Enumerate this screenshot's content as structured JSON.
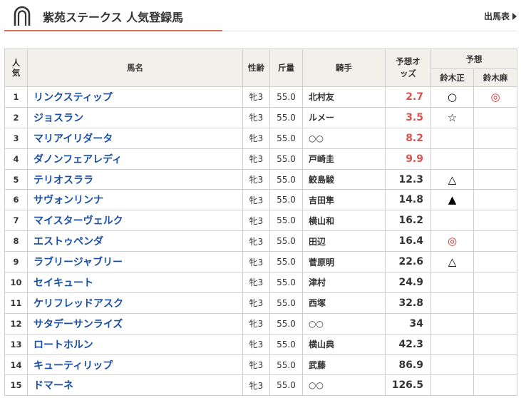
{
  "header": {
    "title": "紫苑ステークス 人気登録馬",
    "entry_link": "出馬表"
  },
  "columns": {
    "rank": "人気",
    "name": "馬名",
    "sexage": "性齢",
    "weight": "斤量",
    "jockey": "騎手",
    "odds": "予想オッズ",
    "forecast": "予想",
    "tipster1": "鈴木正",
    "tipster2": "鈴木麻"
  },
  "rows": [
    {
      "rank": "1",
      "name": "リンクスティップ",
      "sexage": "牝3",
      "weight": "55.0",
      "jockey": "北村友",
      "odds": "2.7",
      "hot": true,
      "mark1": "○",
      "mark2": "◎"
    },
    {
      "rank": "2",
      "name": "ジョスラン",
      "sexage": "牝3",
      "weight": "55.0",
      "jockey": "ルメー",
      "odds": "3.5",
      "hot": true,
      "mark1": "☆",
      "mark2": ""
    },
    {
      "rank": "3",
      "name": "マリアイリダータ",
      "sexage": "牝3",
      "weight": "55.0",
      "jockey": "○○",
      "odds": "8.2",
      "hot": true,
      "mark1": "",
      "mark2": ""
    },
    {
      "rank": "4",
      "name": "ダノンフェアレディ",
      "sexage": "牝3",
      "weight": "55.0",
      "jockey": "戸崎圭",
      "odds": "9.9",
      "hot": true,
      "mark1": "",
      "mark2": ""
    },
    {
      "rank": "5",
      "name": "テリオスララ",
      "sexage": "牝3",
      "weight": "55.0",
      "jockey": "鮫島駿",
      "odds": "12.3",
      "hot": false,
      "mark1": "△",
      "mark2": ""
    },
    {
      "rank": "6",
      "name": "サヴォンリンナ",
      "sexage": "牝3",
      "weight": "55.0",
      "jockey": "吉田隼",
      "odds": "14.8",
      "hot": false,
      "mark1": "▲",
      "mark2": ""
    },
    {
      "rank": "7",
      "name": "マイスターヴェルク",
      "sexage": "牝3",
      "weight": "55.0",
      "jockey": "横山和",
      "odds": "16.2",
      "hot": false,
      "mark1": "",
      "mark2": ""
    },
    {
      "rank": "8",
      "name": "エストゥペンダ",
      "sexage": "牝3",
      "weight": "55.0",
      "jockey": "田辺",
      "odds": "16.4",
      "hot": false,
      "mark1": "◎",
      "mark2": ""
    },
    {
      "rank": "9",
      "name": "ラブリージャブリー",
      "sexage": "牝3",
      "weight": "55.0",
      "jockey": "菅原明",
      "odds": "22.6",
      "hot": false,
      "mark1": "△",
      "mark2": ""
    },
    {
      "rank": "10",
      "name": "セイキュート",
      "sexage": "牝3",
      "weight": "55.0",
      "jockey": "津村",
      "odds": "24.9",
      "hot": false,
      "mark1": "",
      "mark2": ""
    },
    {
      "rank": "11",
      "name": "ケリフレッドアスク",
      "sexage": "牝3",
      "weight": "55.0",
      "jockey": "西塚",
      "odds": "32.8",
      "hot": false,
      "mark1": "",
      "mark2": ""
    },
    {
      "rank": "12",
      "name": "サタデーサンライズ",
      "sexage": "牝3",
      "weight": "55.0",
      "jockey": "○○",
      "odds": "34",
      "hot": false,
      "mark1": "",
      "mark2": ""
    },
    {
      "rank": "13",
      "name": "ロートホルン",
      "sexage": "牝3",
      "weight": "55.0",
      "jockey": "横山典",
      "odds": "42.3",
      "hot": false,
      "mark1": "",
      "mark2": ""
    },
    {
      "rank": "14",
      "name": "キューティリップ",
      "sexage": "牝3",
      "weight": "55.0",
      "jockey": "武藤",
      "odds": "86.9",
      "hot": false,
      "mark1": "",
      "mark2": ""
    },
    {
      "rank": "15",
      "name": "ドマーネ",
      "sexage": "牝3",
      "weight": "55.0",
      "jockey": "○○",
      "odds": "126.5",
      "hot": false,
      "mark1": "",
      "mark2": ""
    }
  ],
  "colors": {
    "accent_underline": "#d96d5f",
    "horse_name": "#1a4fa3",
    "hot_odds": "#d9534f",
    "header_bg": "#f2f0eb"
  },
  "icons": {
    "logo": "horseshoe-icon",
    "entry_arrow": "triangle-right-icon"
  }
}
